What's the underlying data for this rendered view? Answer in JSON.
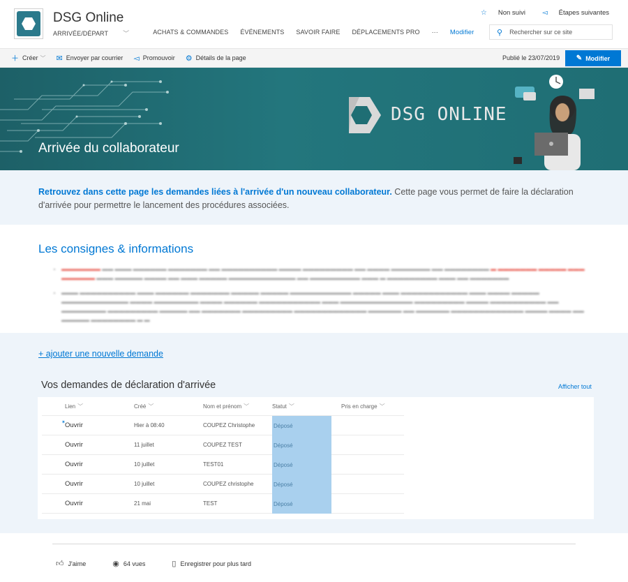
{
  "header": {
    "site_title": "DSG Online",
    "nav": [
      "ARRIVÉE/DÉPART",
      "ACHATS & COMMANDES",
      "ÉVÉNEMENTS",
      "SAVOIR FAIRE",
      "DÉPLACEMENTS PRO",
      "···"
    ],
    "nav_edit": "Modifier",
    "follow": "Non suivi",
    "next_steps": "Étapes suivantes",
    "search_placeholder": "Rechercher sur ce site"
  },
  "command_bar": {
    "new": "Créer",
    "send": "Envoyer par courrier",
    "promote": "Promouvoir",
    "page_details": "Détails de la page",
    "published": "Publié le 23/07/2019",
    "edit_button": "Modifier"
  },
  "banner": {
    "title": "Arrivée du collaborateur",
    "brand": "DSG ONLINE"
  },
  "intro": {
    "bold": "Retrouvez dans cette page les demandes liées à l'arrivée d'un nouveau collaborateur.",
    "rest": " Cette page vous permet de faire la déclaration d'arrivée pour permettre le lancement des procédures associées."
  },
  "consignes": {
    "title": "Les consignes & informations"
  },
  "requests": {
    "add_link": "+ ajouter une nouvelle demande",
    "list_title": "Vos demandes de déclaration d'arrivée",
    "show_all": "Afficher tout",
    "columns": [
      "Lien",
      "Créé",
      "Nom et prénom",
      "Statut",
      "Pris en charge"
    ],
    "rows": [
      {
        "link": "Ouvrir",
        "created": "Hier à 08:40",
        "name": "COUPEZ Christophe",
        "status": "Déposé",
        "taken": ""
      },
      {
        "link": "Ouvrir",
        "created": "11 juillet",
        "name": "COUPEZ TEST",
        "status": "Déposé",
        "taken": ""
      },
      {
        "link": "Ouvrir",
        "created": "10 juillet",
        "name": "TEST01",
        "status": "Déposé",
        "taken": ""
      },
      {
        "link": "Ouvrir",
        "created": "10 juillet",
        "name": "COUPEZ christophe",
        "status": "Déposé",
        "taken": ""
      },
      {
        "link": "Ouvrir",
        "created": "21 mai",
        "name": "TEST",
        "status": "Déposé",
        "taken": ""
      }
    ]
  },
  "footer": {
    "like": "J'aime",
    "views": "64 vues",
    "save": "Enregistrer pour plus tard"
  },
  "colors": {
    "accent": "#0078d4",
    "banner": "#1f6e74",
    "status_fill": "#a9d0ee",
    "section_bg": "#eef4fa"
  }
}
